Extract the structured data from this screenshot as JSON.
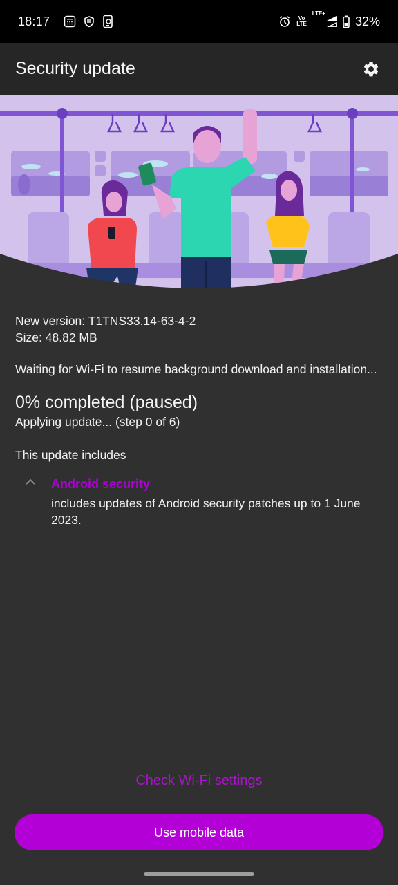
{
  "status_bar": {
    "time": "18:17",
    "left_icons": [
      "calculator-icon",
      "shield-hand-icon",
      "phone-sync-icon"
    ],
    "right_icons": [
      "alarm-icon",
      "volte-icon",
      "lte-plus-icon",
      "signal-icon",
      "battery-icon"
    ],
    "volte_top": "Vo",
    "volte_bottom": "LTE",
    "network": "LTE+",
    "battery": "32%"
  },
  "app_bar": {
    "title": "Security update",
    "settings_icon": "gear-icon"
  },
  "hero": {
    "description": "Illustration of people on a subway train using phones"
  },
  "update_info": {
    "version_line": "New version: T1TNS33.14-63-4-2",
    "size_line": "Size: 48.82 MB",
    "status_message": "Waiting for Wi-Fi to resume background download and installation...",
    "progress_percent": 0,
    "progress_title": "0% completed (paused)",
    "step_text": "Applying update... (step 0 of 6)"
  },
  "includes": {
    "heading": "This update includes",
    "sections": [
      {
        "title": "Android security",
        "expanded": true,
        "description": "includes updates of Android security patches up to 1 June 2023."
      }
    ]
  },
  "actions": {
    "wifi_link": "Check Wi-Fi settings",
    "primary_button": "Use mobile data"
  },
  "colors": {
    "accent": "#b200d6",
    "link": "#a716c8",
    "background": "#303030",
    "app_bar": "#262626",
    "status_bar": "#000000"
  }
}
